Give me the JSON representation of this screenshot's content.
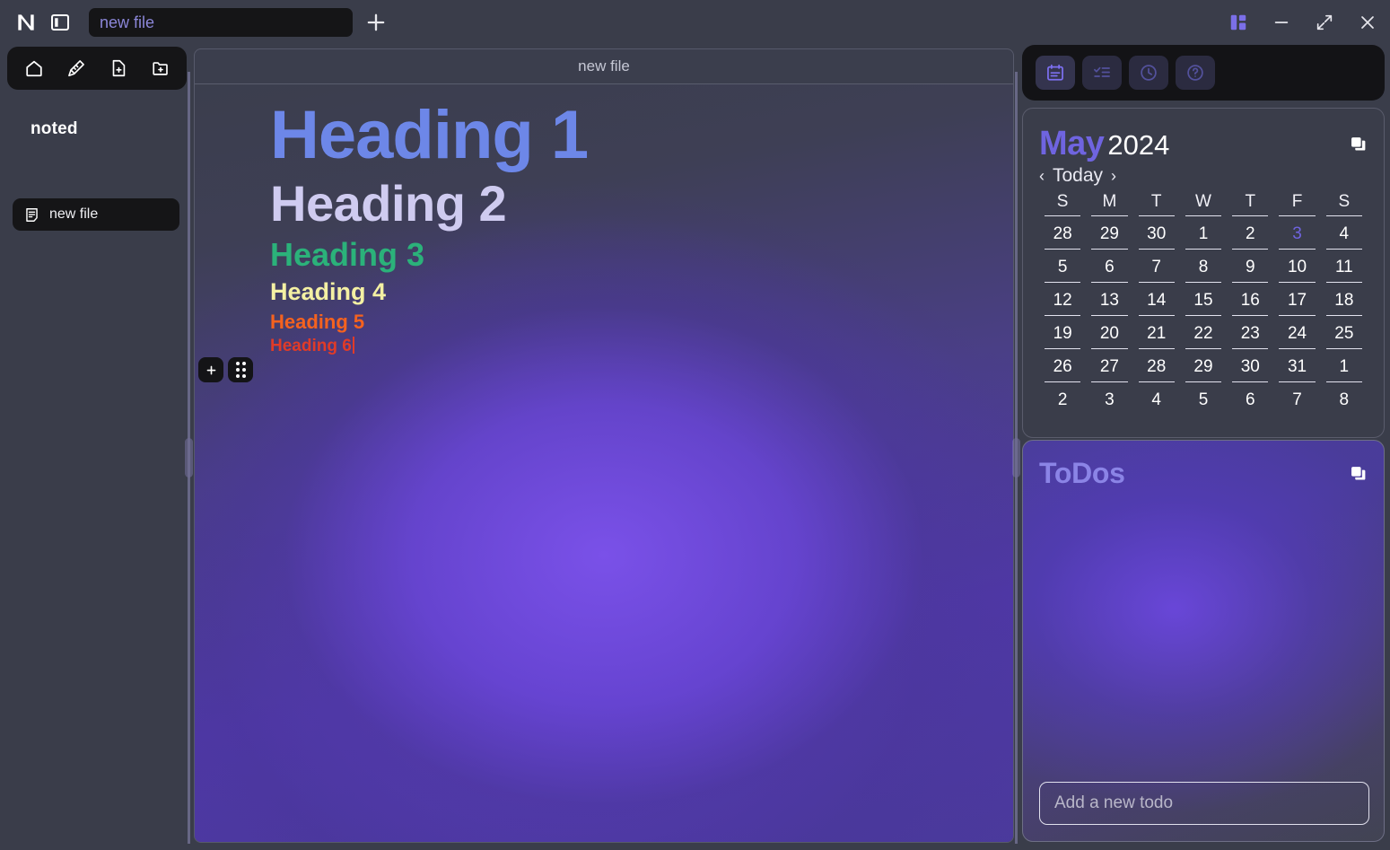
{
  "window": {
    "app_logo": "noted-n-logo",
    "controls": {
      "layout_toggle": "layout-grid-icon",
      "minimize": "minimize-icon",
      "maximize": "maximize-icon",
      "close": "close-icon"
    }
  },
  "titlebar": {
    "sidebar_toggle": "panel-left-icon",
    "file_title_value": "new file",
    "file_title_placeholder": "new file",
    "new_tab_label": "+"
  },
  "sidebar": {
    "tools": [
      {
        "name": "home-icon",
        "label": "Home"
      },
      {
        "name": "magic-pen-icon",
        "label": "Quick note"
      },
      {
        "name": "file-plus-icon",
        "label": "New file"
      },
      {
        "name": "folder-plus-icon",
        "label": "New folder"
      }
    ],
    "workspace": "noted",
    "files": [
      {
        "icon": "note-file-icon",
        "label": "new file",
        "active": true
      }
    ]
  },
  "editor": {
    "tab_title": "new file",
    "block_handle": {
      "add_label": "+",
      "drag_label": "drag-handle"
    },
    "blocks": [
      {
        "level": "h1",
        "text": "Heading 1",
        "color": "#6d87e8"
      },
      {
        "level": "h2",
        "text": "Heading 2",
        "color": "#cfcbf0"
      },
      {
        "level": "h3",
        "text": "Heading 3",
        "color": "#2bb27a"
      },
      {
        "level": "h4",
        "text": "Heading 4",
        "color": "#f4f0a3"
      },
      {
        "level": "h5",
        "text": "Heading 5",
        "color": "#f4621f"
      },
      {
        "level": "h6",
        "text": "Heading 6",
        "color": "#e03b28"
      }
    ]
  },
  "right_panel": {
    "tabs": [
      {
        "name": "calendar-tab",
        "icon": "calendar-icon",
        "active": true
      },
      {
        "name": "tasks-tab",
        "icon": "checklist-icon",
        "active": false
      },
      {
        "name": "timer-tab",
        "icon": "clock-icon",
        "active": false
      },
      {
        "name": "help-tab",
        "icon": "question-circle-icon",
        "active": false
      }
    ],
    "calendar": {
      "month": "May",
      "year": "2024",
      "prev_label": "‹",
      "today_label": "Today",
      "next_label": "›",
      "copy_icon": "copy-icon",
      "weekdays": [
        "S",
        "M",
        "T",
        "W",
        "T",
        "F",
        "S"
      ],
      "today_date": "3",
      "weeks": [
        [
          "28",
          "29",
          "30",
          "1",
          "2",
          "3",
          "4"
        ],
        [
          "5",
          "6",
          "7",
          "8",
          "9",
          "10",
          "11"
        ],
        [
          "12",
          "13",
          "14",
          "15",
          "16",
          "17",
          "18"
        ],
        [
          "19",
          "20",
          "21",
          "22",
          "23",
          "24",
          "25"
        ],
        [
          "26",
          "27",
          "28",
          "29",
          "30",
          "31",
          "1"
        ],
        [
          "2",
          "3",
          "4",
          "5",
          "6",
          "7",
          "8"
        ]
      ]
    },
    "todos": {
      "title": "ToDos",
      "copy_icon": "copy-icon",
      "items": [],
      "input_value": "",
      "input_placeholder": "Add a new todo"
    }
  },
  "colors": {
    "accent": "#6f64e0",
    "window_bg": "#3a3d4a",
    "dark_chrome": "#151517",
    "editor_glow": "#5038a8"
  }
}
